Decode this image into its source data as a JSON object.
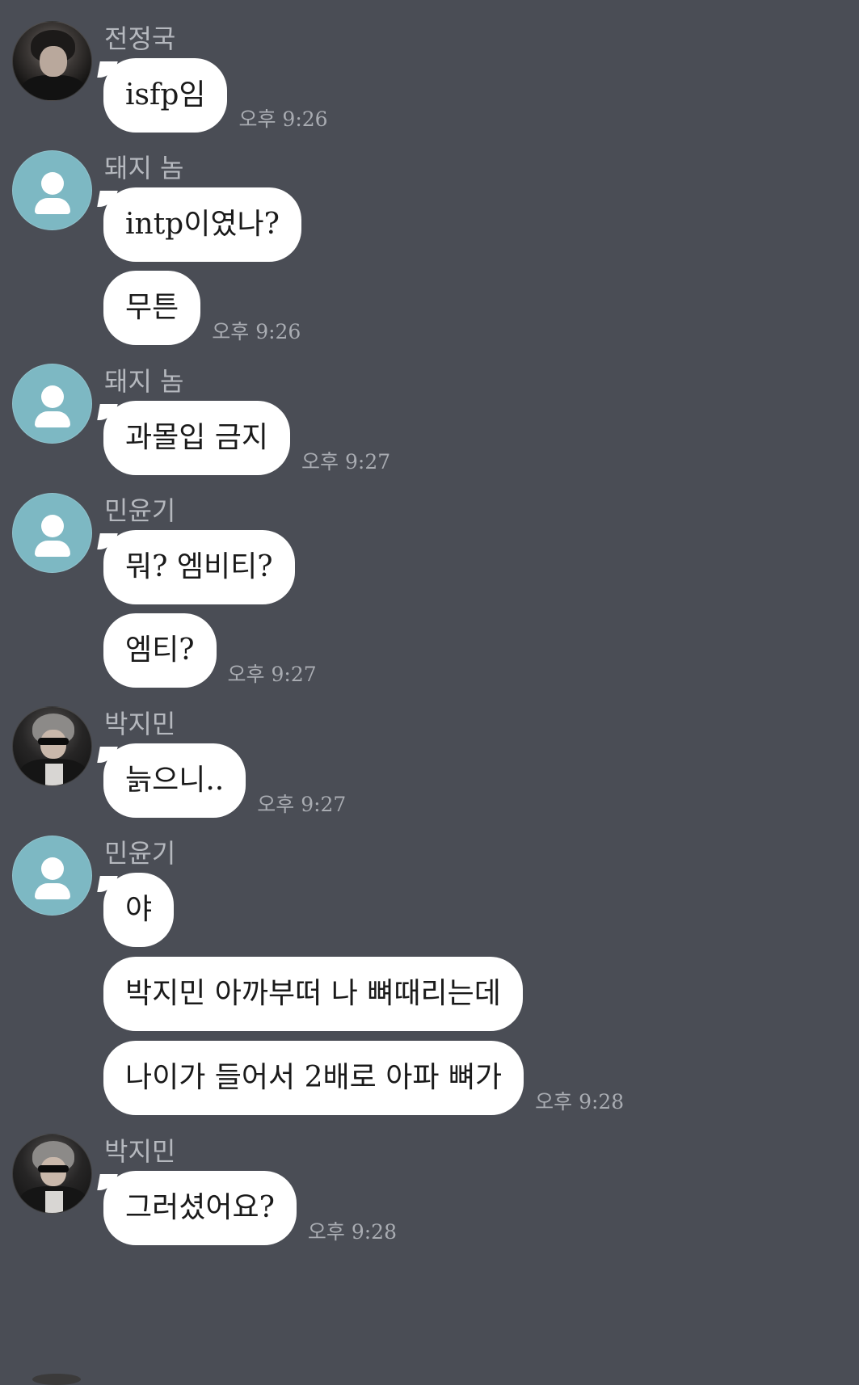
{
  "chat": {
    "groups": [
      {
        "sender": "전정국",
        "avatar": "photo",
        "messages": [
          {
            "text": "isfp임",
            "time": "오후 9:26"
          }
        ]
      },
      {
        "sender": "돼지 놈",
        "avatar": "default",
        "messages": [
          {
            "text": "intp이였나?",
            "time": ""
          },
          {
            "text": "무튼",
            "time": "오후 9:26"
          }
        ]
      },
      {
        "sender": "돼지 놈",
        "avatar": "default",
        "messages": [
          {
            "text": "과몰입 금지",
            "time": "오후 9:27"
          }
        ]
      },
      {
        "sender": "민윤기",
        "avatar": "default",
        "messages": [
          {
            "text": "뭐? 엠비티?",
            "time": ""
          },
          {
            "text": "엠티?",
            "time": "오후 9:27"
          }
        ]
      },
      {
        "sender": "박지민",
        "avatar": "photo2",
        "messages": [
          {
            "text": "늙으니..",
            "time": "오후 9:27"
          }
        ]
      },
      {
        "sender": "민윤기",
        "avatar": "default",
        "messages": [
          {
            "text": "야",
            "time": ""
          },
          {
            "text": "박지민 아까부떠 나 뼈때리는데",
            "time": ""
          },
          {
            "text": "나이가 들어서 2배로 아파 뼈가",
            "time": "오후 9:28"
          }
        ]
      },
      {
        "sender": "박지민",
        "avatar": "photo2",
        "messages": [
          {
            "text": "그러셨어요?",
            "time": "오후 9:28"
          }
        ]
      }
    ]
  },
  "colors": {
    "background": "#4a4d55",
    "bubble": "#ffffff",
    "default_avatar": "#7db8c3",
    "sender_text": "#b5b8be",
    "time_text": "#a9acb2"
  }
}
